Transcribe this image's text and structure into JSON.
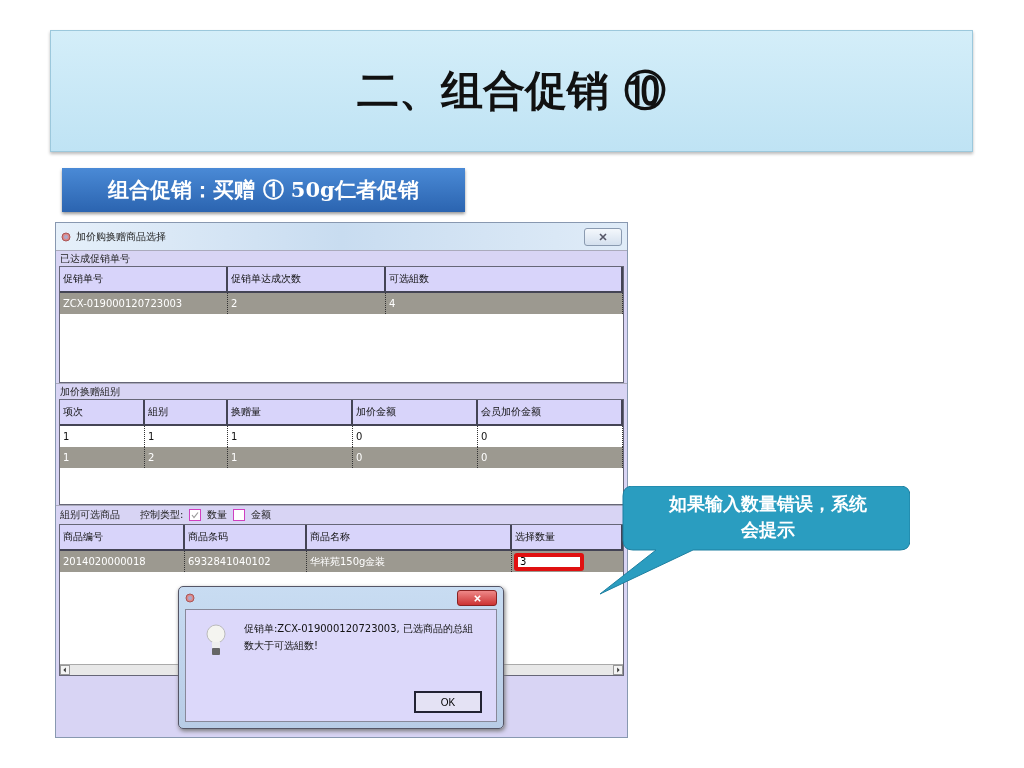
{
  "slide": {
    "title": "二、组合促销 ⑩",
    "subtitle": "组合促销：买赠 ① 50g仁者促销",
    "callout": "如果输入数量错误，系统会提示"
  },
  "window": {
    "title": "加价购换赠商品选择"
  },
  "promotions": {
    "legend": "已达成促销单号",
    "columns": [
      "促销单号",
      "促销单达成次数",
      "可选組数"
    ],
    "rows": [
      {
        "cells": [
          "ZCX-019000120723003",
          "2",
          "4"
        ],
        "selected": true
      }
    ]
  },
  "groups": {
    "legend": "加价换赠組别",
    "columns": [
      "项次",
      "組别",
      "换赠量",
      "加价金额",
      "会员加价金额"
    ],
    "rows": [
      {
        "cells": [
          "1",
          "1",
          "1",
          "0",
          "0"
        ],
        "selected": false
      },
      {
        "cells": [
          "1",
          "2",
          "1",
          "0",
          "0"
        ],
        "selected": true
      }
    ]
  },
  "products": {
    "legend": "組别可选商品",
    "control_label": "控制类型:",
    "options": [
      {
        "label": "数量",
        "checked": true
      },
      {
        "label": "金额",
        "checked": false
      }
    ],
    "columns": [
      "商品编号",
      "商品条码",
      "商品名称",
      "选择数量"
    ],
    "rows": [
      {
        "cells": [
          "2014020000018",
          "6932841040102",
          "华祥苑150g金装"
        ],
        "quantity": "3",
        "selected": true
      }
    ]
  },
  "message_box": {
    "text": "促销单:ZCX-019000120723003, 已选商品的总組数大于可选組数!",
    "button": "OK"
  }
}
